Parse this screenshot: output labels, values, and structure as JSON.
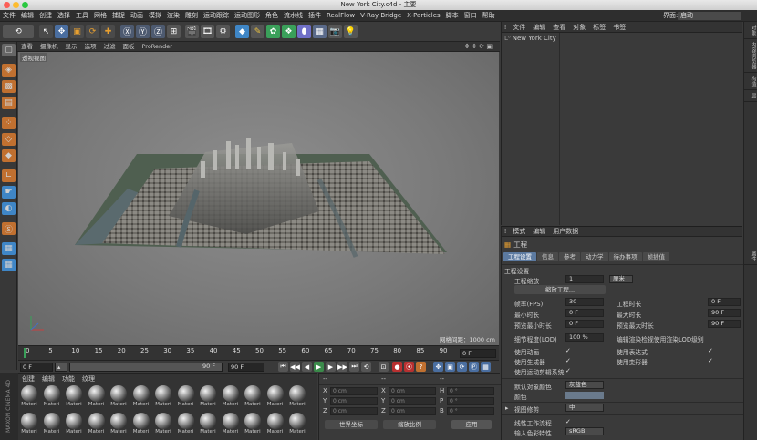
{
  "window": {
    "title": "New York City.c4d - 主要"
  },
  "menubar": {
    "items": [
      "文件",
      "编辑",
      "创建",
      "选择",
      "工具",
      "网格",
      "捕捉",
      "动画",
      "模拟",
      "渲染",
      "雕刻",
      "运动跟踪",
      "运动图形",
      "角色",
      "流水线",
      "插件",
      "RealFlow",
      "V-Ray Bridge",
      "X-Particles",
      "脚本",
      "窗口",
      "帮助"
    ],
    "layout_label": "界面:",
    "layout_value": "启动"
  },
  "viewport": {
    "menu": [
      "查看",
      "摄像机",
      "显示",
      "选项",
      "过滤",
      "面板",
      "ProRender"
    ],
    "label": "透视视图",
    "grid_info": "网格间距：1000 cm"
  },
  "timeline": {
    "ticks": [
      "0",
      "5",
      "10",
      "15",
      "20",
      "25",
      "30",
      "35",
      "40",
      "45",
      "50",
      "55",
      "60",
      "65",
      "70",
      "75",
      "80",
      "85",
      "90"
    ],
    "frame_end_readout": "0 F"
  },
  "transport": {
    "current_frame": "0 F",
    "start_frame": "0 F",
    "end_frame": "90 F",
    "preview_end": "90 F"
  },
  "materials": {
    "menu": [
      "创建",
      "编辑",
      "功能",
      "纹理"
    ],
    "label": "Materi",
    "count": 26
  },
  "brand": {
    "text": "MAXON CINEMA 4D"
  },
  "coordinates": {
    "header_left": "--",
    "header_mid": "--",
    "header_right": "--",
    "rows": [
      {
        "a": "X",
        "av": "0 cm",
        "b": "X",
        "bv": "0 cm",
        "c": "H",
        "cv": "0 °"
      },
      {
        "a": "Y",
        "av": "0 cm",
        "b": "Y",
        "bv": "0 cm",
        "c": "P",
        "cv": "0 °"
      },
      {
        "a": "Z",
        "av": "0 cm",
        "b": "Z",
        "bv": "0 cm",
        "c": "B",
        "cv": "0 °"
      }
    ],
    "world_dropdown": "世界坐标",
    "scale_dropdown": "缩放比例",
    "apply_button": "应用"
  },
  "object_manager": {
    "menu": [
      "文件",
      "编辑",
      "查看",
      "对象",
      "标签",
      "书签"
    ],
    "root_item": "New York City"
  },
  "right_strip": [
    "对象",
    "内容浏览器",
    "构造",
    "层",
    "属性"
  ],
  "attributes": {
    "menu": [
      "模式",
      "编辑",
      "用户数据"
    ],
    "title": "工程",
    "tabs": [
      "工程设置",
      "信息",
      "参考",
      "动力学",
      "待办事项",
      "帧插值"
    ],
    "section": "工程设置",
    "scale_label": "工程缩放",
    "scale_value": "1",
    "scale_unit": "厘米",
    "scale_button": "缩放工程...",
    "fps_label": "帧率(FPS)",
    "fps_value": "30",
    "duration_label": "工程时长",
    "duration_value": "0 F",
    "min_time_label": "最小时长",
    "min_time_value": "0 F",
    "max_time_label": "最大时长",
    "max_time_value": "90 F",
    "preview_min_label": "预览最小时长",
    "preview_min_value": "0 F",
    "preview_max_label": "预览最大时长",
    "preview_max_value": "90 F",
    "lod_label": "细节程度(LOD)",
    "lod_value": "100 %",
    "lod_render_label": "编辑渲染检视使用渲染LOD级别",
    "use_anim": "使用动画",
    "use_expr": "使用表达式",
    "use_gen": "使用生成器",
    "use_deform": "使用变形器",
    "use_motion": "使用运动剪辑系统",
    "default_color_label": "默认对象颜色",
    "default_color_value": "灰蓝色",
    "color_label": "颜色",
    "view_clip_label": "视图修剪",
    "view_clip_value": "中",
    "linear_label": "线性工作流程",
    "input_color_label": "输入色彩特性",
    "input_color_value": "sRGB",
    "check": "✓"
  },
  "colors": {
    "accent": "#5c7aa0",
    "panel": "#3a3a3a"
  }
}
